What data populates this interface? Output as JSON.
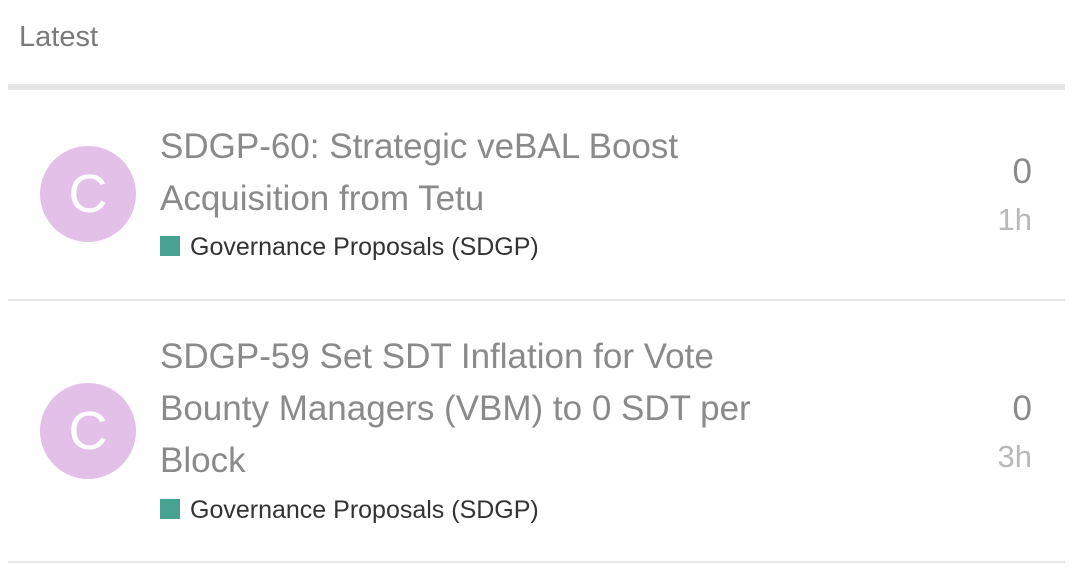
{
  "header": {
    "label": "Latest"
  },
  "colors": {
    "avatar_bg": "#e2c0e8",
    "category_swatch": "#47a291",
    "title_text": "#8a8a8a",
    "age_text": "#b8b8b8",
    "divider": "#e6e6e6"
  },
  "topics": [
    {
      "avatar_letter": "C",
      "title": "SDGP-60: Strategic veBAL Boost Acquisition from Tetu",
      "category": "Governance Proposals (SDGP)",
      "replies": "0",
      "age": "1h"
    },
    {
      "avatar_letter": "C",
      "title": "SDGP-59 Set SDT Inflation for Vote Bounty Managers (VBM) to 0 SDT per Block",
      "category": "Governance Proposals (SDGP)",
      "replies": "0",
      "age": "3h"
    }
  ]
}
